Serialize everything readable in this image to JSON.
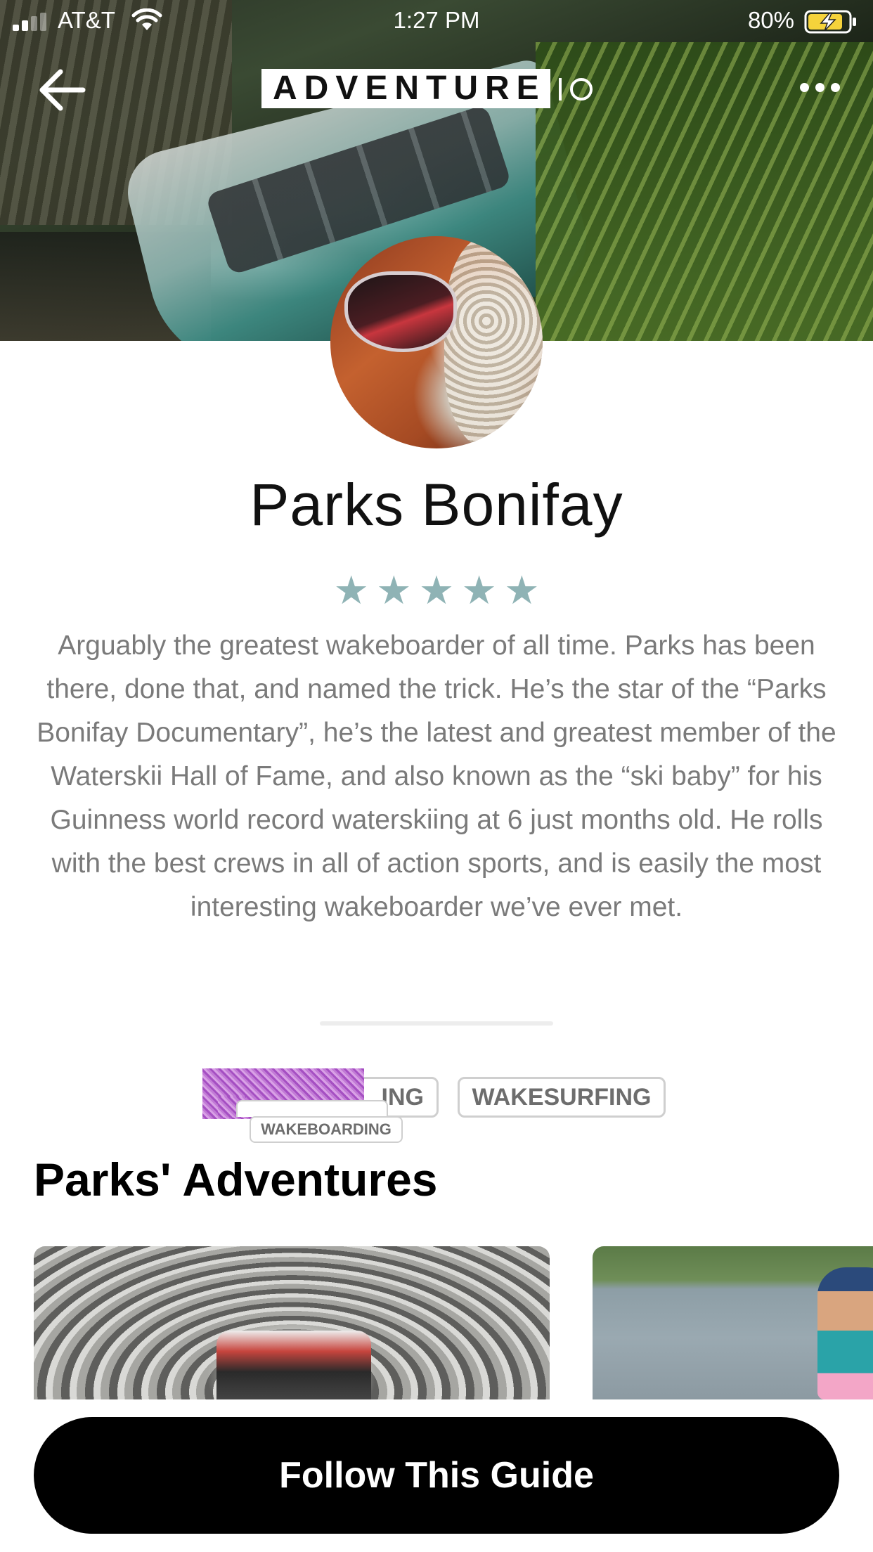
{
  "status_bar": {
    "carrier": "AT&T",
    "time": "1:27 PM",
    "battery": "80%"
  },
  "header": {
    "logo_text": "ADVENTURE",
    "icons": {
      "back": "arrow-left-icon",
      "more": "ellipsis-icon",
      "logo_mark": "logo-mark-icon"
    }
  },
  "profile": {
    "name": "Parks Bonifay",
    "rating": 5,
    "stars": [
      "★",
      "★",
      "★",
      "★",
      "★"
    ],
    "bio": "Arguably the greatest wakeboarder of all time. Parks has been there, done that, and named the trick. He’s the star of the “Parks Bonifay Documentary”, he’s the latest and greatest member of the Waterskii Hall of Fame, and also known as the “ski baby” for his Guinness world record waterskiing at 6 just months old. He rolls with the best crews in all of action sports, and is easily the most interesting wakeboarder we’ve ever met."
  },
  "tags": {
    "main_suffix": "ING",
    "wakesurfing": "WAKESURFING",
    "wakeboarding_overlay": "WAKEBOARDING"
  },
  "section": {
    "title": "Parks' Adventures"
  },
  "footer": {
    "follow_button": "Follow This Guide"
  },
  "colors": {
    "star": "#8fb3b5",
    "bio_text": "#7a7a7a",
    "button_bg": "#000000"
  }
}
